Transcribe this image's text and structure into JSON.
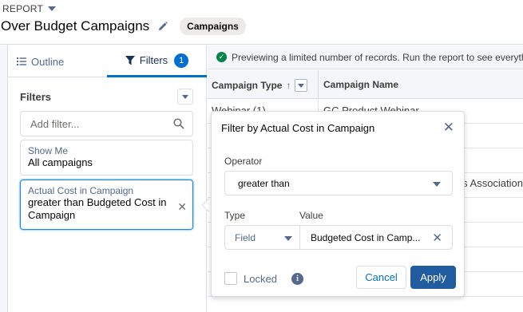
{
  "header": {
    "report_label": "REPORT",
    "title": "Over Budget Campaigns",
    "type_badge": "Campaigns"
  },
  "panel": {
    "tabs": [
      {
        "label": "Outline",
        "icon": "list-icon"
      },
      {
        "label": "Filters",
        "icon": "funnel-icon",
        "count": "1"
      }
    ],
    "filters_heading": "Filters",
    "add_filter_placeholder": "Add filter...",
    "filters": [
      {
        "label": "Show Me",
        "value": "All campaigns"
      },
      {
        "label": "Actual Cost in Campaign",
        "value": "greater than Budgeted Cost in Campaign"
      }
    ]
  },
  "grid": {
    "notice": "Previewing a limited number of records. Run the report to see everything.",
    "columns": [
      "Campaign Type",
      "Campaign Name"
    ],
    "rows": [
      {
        "type": "Webinar (1)",
        "name": "GC Product Webinar"
      },
      {
        "type": "",
        "name": "s Association"
      }
    ]
  },
  "popover": {
    "title": "Filter by Actual Cost in Campaign",
    "operator_label": "Operator",
    "operator_value": "greater than",
    "type_label": "Type",
    "type_value": "Field",
    "value_label": "Value",
    "value_value": "Budgeted Cost in Camp...",
    "locked_label": "Locked",
    "cancel_label": "Cancel",
    "apply_label": "Apply"
  },
  "colors": {
    "brand": "#0070d2",
    "apply_button": "#215ca0",
    "success": "#04844b"
  }
}
